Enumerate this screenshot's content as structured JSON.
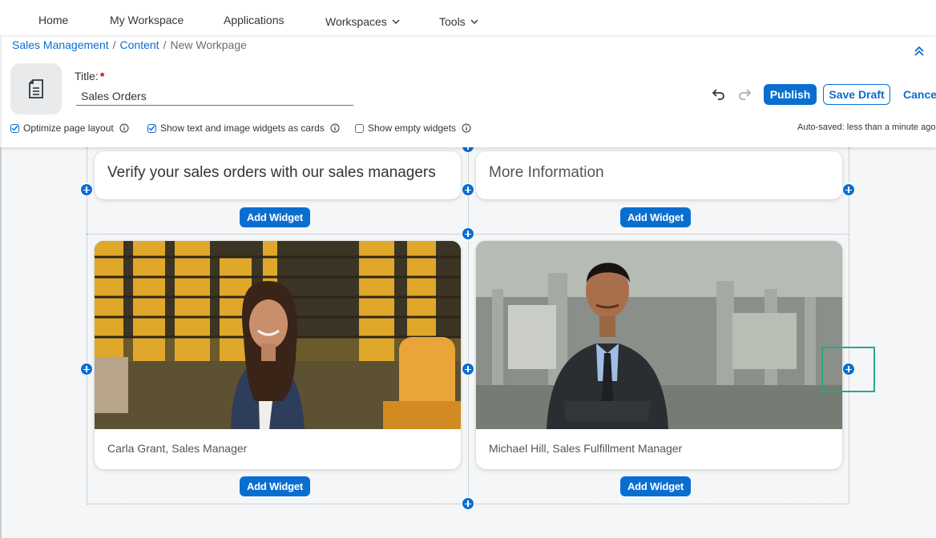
{
  "nav": {
    "items": [
      {
        "label": "Home"
      },
      {
        "label": "My Workspace"
      },
      {
        "label": "Applications"
      },
      {
        "label": "Workspaces"
      },
      {
        "label": "Tools"
      }
    ]
  },
  "breadcrumb": {
    "items": [
      {
        "label": "Sales Management"
      },
      {
        "label": "Content"
      },
      {
        "label": "New Workpage"
      }
    ],
    "separator": "/"
  },
  "header": {
    "title_label": "Title:",
    "required_mark": "*",
    "title_value": "Sales Orders",
    "publish_label": "Publish",
    "save_draft_label": "Save Draft",
    "cancel_label": "Cancel",
    "autosave_text": "Auto-saved: less than a minute ago"
  },
  "options": {
    "optimize_layout": {
      "label": "Optimize page layout",
      "checked": true
    },
    "text_image_cards": {
      "label": "Show text and image widgets as cards",
      "checked": true
    },
    "empty_widgets": {
      "label": "Show empty widgets",
      "checked": false
    }
  },
  "canvas": {
    "add_widget_label": "Add Widget",
    "cards": {
      "text_left": "Verify your sales orders with our sales managers",
      "text_right": "More Information",
      "caption_left": "Carla Grant, Sales Manager",
      "caption_right": "Michael Hill, Sales Fulfillment Manager"
    }
  },
  "colors": {
    "accent": "#0a6ed1",
    "required": "#bb0000",
    "focus": "#2aa784",
    "background": "#f5f6f7"
  }
}
